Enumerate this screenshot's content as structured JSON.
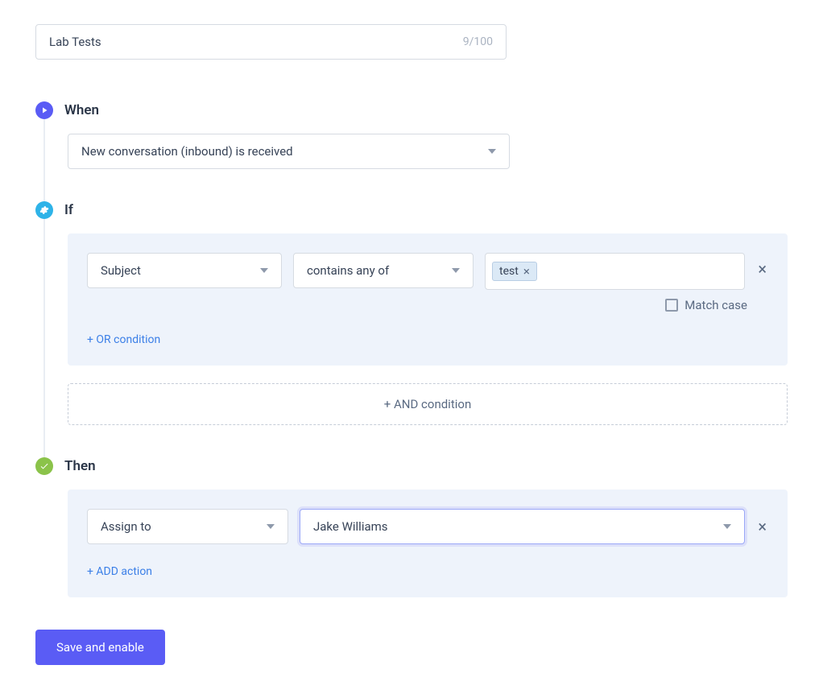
{
  "rule_name": "Lab Tests",
  "rule_name_counter": "9/100",
  "when": {
    "label": "When",
    "trigger": "New conversation (inbound) is received"
  },
  "if": {
    "label": "If",
    "conditions": [
      {
        "field": "Subject",
        "operator": "contains any of",
        "tags": [
          "test"
        ]
      }
    ],
    "match_case_label": "Match case",
    "or_condition_label": "+ OR condition",
    "and_condition_label": "+ AND condition"
  },
  "then": {
    "label": "Then",
    "actions": [
      {
        "action": "Assign to",
        "value": "Jake Williams"
      }
    ],
    "add_action_label": "+ ADD action"
  },
  "save_button_label": "Save and enable"
}
